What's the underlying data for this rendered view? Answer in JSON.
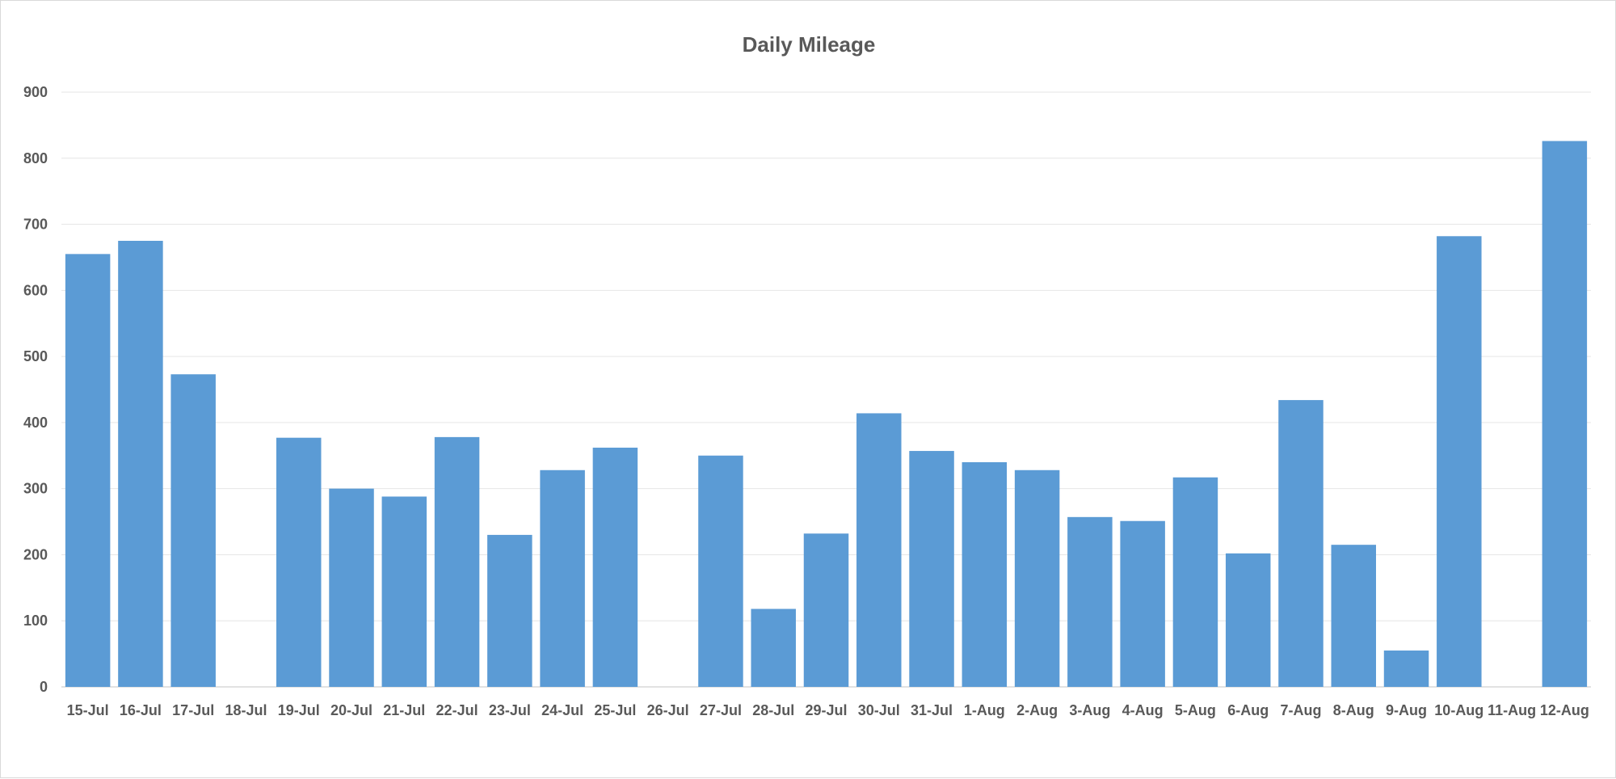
{
  "chart_data": {
    "type": "bar",
    "title": "Daily Mileage",
    "xlabel": "",
    "ylabel": "",
    "ylim": [
      0,
      900
    ],
    "yticks": [
      0,
      100,
      200,
      300,
      400,
      500,
      600,
      700,
      800,
      900
    ],
    "grid": true,
    "legend": "none",
    "bar_color": "#5b9bd5",
    "categories": [
      "15-Jul",
      "16-Jul",
      "17-Jul",
      "18-Jul",
      "19-Jul",
      "20-Jul",
      "21-Jul",
      "22-Jul",
      "23-Jul",
      "24-Jul",
      "25-Jul",
      "26-Jul",
      "27-Jul",
      "28-Jul",
      "29-Jul",
      "30-Jul",
      "31-Jul",
      "1-Aug",
      "2-Aug",
      "3-Aug",
      "4-Aug",
      "5-Aug",
      "6-Aug",
      "7-Aug",
      "8-Aug",
      "9-Aug",
      "10-Aug",
      "11-Aug",
      "12-Aug"
    ],
    "values": [
      655,
      675,
      473,
      0,
      377,
      300,
      288,
      378,
      230,
      328,
      362,
      0,
      350,
      118,
      232,
      414,
      357,
      340,
      328,
      257,
      251,
      317,
      202,
      434,
      215,
      55,
      682,
      0,
      826
    ]
  }
}
